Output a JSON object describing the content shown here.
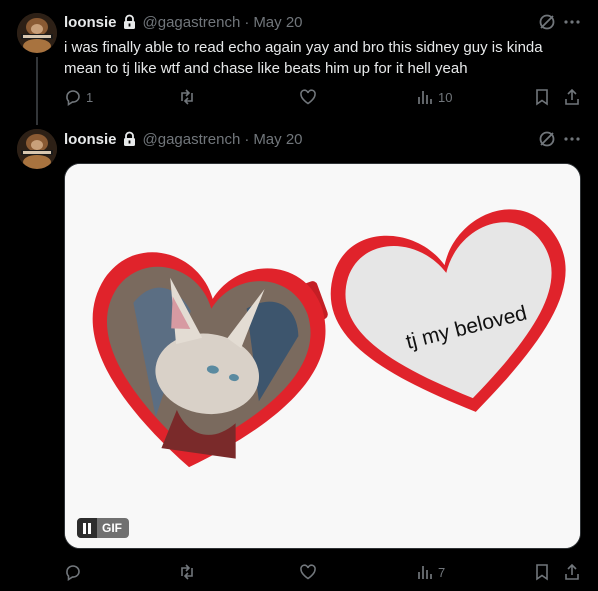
{
  "tweets": [
    {
      "display_name": "loonsie",
      "handle": "@gagastrench",
      "separator": "·",
      "date": "May 20",
      "text": "i was finally able to read echo again yay and bro this sidney guy is kinda mean to tj like wtf and chase like beats him up for it hell yeah",
      "reply_count": "1",
      "views": "10"
    },
    {
      "display_name": "loonsie",
      "handle": "@gagastrench",
      "separator": "·",
      "date": "May 20",
      "media": {
        "caption": "tj my beloved",
        "badge": "GIF"
      },
      "views": "7"
    }
  ],
  "icons": {
    "lock": "lock-icon",
    "grok": "grok-icon",
    "more": "more-icon",
    "reply": "reply-icon",
    "repost": "repost-icon",
    "like": "heart-icon",
    "views": "views-icon",
    "bookmark": "bookmark-icon",
    "share": "share-icon",
    "pause": "pause-icon"
  },
  "colors": {
    "background": "#000000",
    "text": "#e7e9ea",
    "muted": "#71767b",
    "heart_frame": "#e0232b"
  }
}
